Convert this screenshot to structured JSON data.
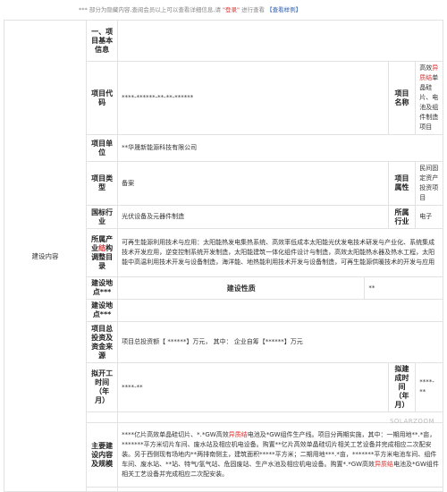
{
  "notice": {
    "text1": "*** 部分为隐藏内容,查阅会员以上可以查看详细信息,请",
    "login": "\"登录\"",
    "text2": "进行查看",
    "sample": "【查看样例】"
  },
  "side_label": "建设内容",
  "section_title": "一、项目基本信息",
  "fields": {
    "code_label": "项目代码",
    "code_value": "****-******-**-**-******",
    "name_label": "项目名称",
    "name_pre": "高效",
    "name_hl": "异质结",
    "name_post": "单晶硅片、电池及组件制造项目",
    "unit_label": "项目单位",
    "unit_value": "**华晟新能源科技有限公司",
    "type_label": "项目类型",
    "type_value": "备案",
    "attr_label": "项目属性",
    "attr_value": "民间固定资产投资项目",
    "industry_label": "国标行业",
    "industry_value": "光伏设备及元器件制造",
    "belong_label": "所属行业",
    "belong_value": "电子",
    "policy_label_pre": "所属产业",
    "policy_label_hl": "结",
    "policy_label_post": "构调整目录",
    "policy_value": "可再生能源利用技术与应用：太阳能热发电集热系统、高效率低成本太阳能光伏发电技术研发与产业化、系统集成技术开发应用，逆变控制系统开发制造，太阳能建筑一体化组件设计与制造，高效太阳能热水器及热水工程，太阳能中高温利用技术开发与设备制造，海洋能、地热能利用技术开发与设备制造，可再生能源供暖技术的开发与应用",
    "site_label": "建设地点***",
    "nature_label": "建设性质",
    "nature_value": "**",
    "site2_label": "建设地点***",
    "invest_label": "项目总投资及资金来源",
    "invest_value": "项目总投资额【 ******】万元， 其中： 企业自筹【******】万元",
    "start_label": "拟开工时间（年月）",
    "start_value": "****-**",
    "end_label": "拟建成时间（年月）",
    "end_value": "****-**",
    "content_label": "主要建设内容及规模",
    "content_segments": [
      {
        "t": "****亿片高效单晶硅切片、*.*GW高效",
        "hl": false
      },
      {
        "t": "异质结",
        "hl": true
      },
      {
        "t": "电池及*GW组件生产线。项目分两期实施，其中：一期用地**.*亩，*******平方米切片车间、废水站及相应机电设备。购置**亿片高效单晶硅切片相关工艺设备并完成相应二次配安装。另于西侧现有场地内**两排南侧主，建筑面积*****平方米；二期用地***.*亩，*******平方米电池车间、组件车间、废水站、**站、特气/氢气站、危固废站、生产水池及相应机电设备。购置*.*GW高效",
        "hl": false
      },
      {
        "t": "异质结",
        "hl": true
      },
      {
        "t": "电池及*GW组件相关工艺设备并完成相应二次配安装。",
        "hl": false
      }
    ]
  },
  "watermark": "SOLARZOOM"
}
